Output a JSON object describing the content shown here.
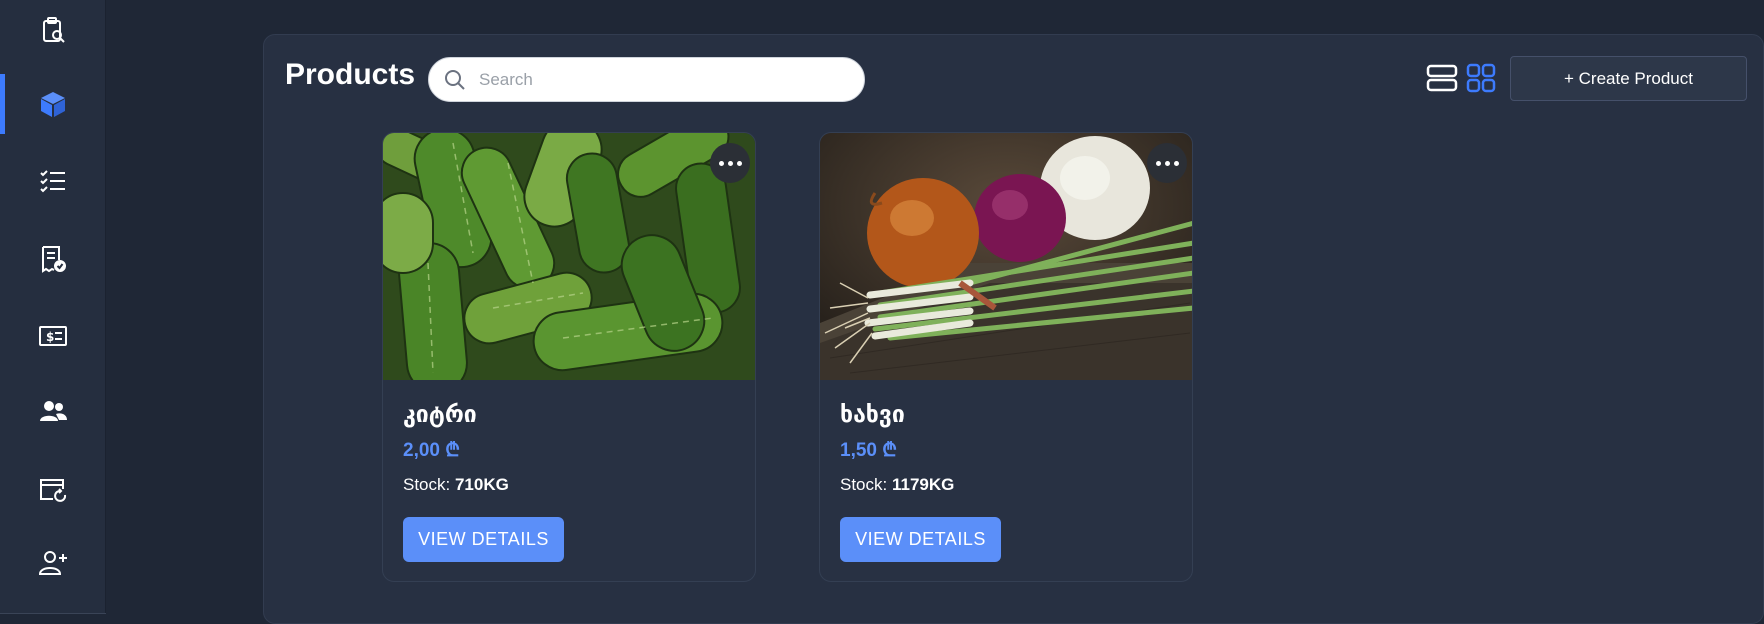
{
  "sidebar": {
    "items": [
      {
        "icon": "clipboard-search-icon",
        "active": false
      },
      {
        "icon": "cube-icon",
        "active": true
      },
      {
        "icon": "checklist-icon",
        "active": false
      },
      {
        "icon": "receipt-check-icon",
        "active": false
      },
      {
        "icon": "money-bill-icon",
        "active": false
      },
      {
        "icon": "users-icon",
        "active": false
      },
      {
        "icon": "window-refresh-icon",
        "active": false
      },
      {
        "icon": "add-user-icon",
        "active": false
      }
    ],
    "accent_color": "#3d7bfd"
  },
  "header": {
    "title": "Products",
    "search_placeholder": "Search",
    "list_view_icon": "list-view-icon",
    "grid_view_icon": "grid-view-icon",
    "create_label": "+ Create Product"
  },
  "products": [
    {
      "name": "კიტრი",
      "price": "2,00 ₾",
      "stock_label": "Stock: ",
      "stock_value": "710KG",
      "button_label": "VIEW DETAILS",
      "image": "cucumbers-photo"
    },
    {
      "name": "ხახვი",
      "price": "1,50 ₾",
      "stock_label": "Stock: ",
      "stock_value": "1179KG",
      "button_label": "VIEW DETAILS",
      "image": "onions-photo"
    }
  ],
  "colors": {
    "background": "#1f2736",
    "panel": "#273042",
    "accent": "#5b8ff9"
  }
}
